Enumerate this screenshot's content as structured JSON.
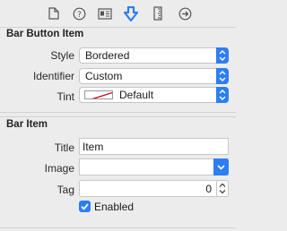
{
  "toolbar": {
    "icons": [
      "file-inspector-icon",
      "quick-help-icon",
      "identity-inspector-icon",
      "attributes-inspector-icon",
      "size-inspector-icon",
      "connections-inspector-icon"
    ],
    "accent_color": "#2d7ef2"
  },
  "bar_button_item": {
    "title": "Bar Button Item",
    "style": {
      "label": "Style",
      "value": "Bordered"
    },
    "identifier": {
      "label": "Identifier",
      "value": "Custom"
    },
    "tint": {
      "label": "Tint",
      "value": "Default"
    }
  },
  "bar_item": {
    "title": "Bar Item",
    "title_field": {
      "label": "Title",
      "value": "Item"
    },
    "image": {
      "label": "Image",
      "value": ""
    },
    "tag": {
      "label": "Tag",
      "value": "0"
    },
    "enabled": {
      "label": "Enabled",
      "checked": true
    }
  }
}
